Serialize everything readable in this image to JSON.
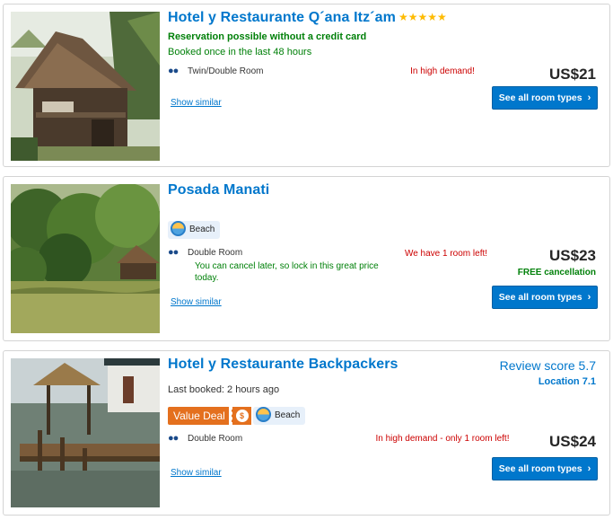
{
  "listings": [
    {
      "name": "Hotel y Restaurante Q´ana Itz´am",
      "stars": "★★★★★",
      "reservation_note": "Reservation possible without a credit card",
      "booked_note": "Booked once in the last 48 hours",
      "room_icon": "people-icon",
      "room_type": "Twin/Double Room",
      "demand": "In high demand!",
      "price": "US$21",
      "cta": "See all room types",
      "similar": "Show similar"
    },
    {
      "name": "Posada Manati",
      "badge": "Beach",
      "badge_icon": "beach-icon",
      "room_icon": "people-icon",
      "room_type": "Double Room",
      "room_note": "You can cancel later, so lock in this great price today.",
      "demand": "We have 1 room left!",
      "price": "US$23",
      "free_cancellation": "FREE cancellation",
      "cta": "See all room types",
      "similar": "Show similar"
    },
    {
      "name": "Hotel y Restaurante Backpackers",
      "review": "Review score 5.7",
      "location": "Location 7.1",
      "last_booked": "Last booked: 2 hours ago",
      "deal": "Value Deal",
      "deal_icon": "piggy-bank-icon",
      "badge": "Beach",
      "badge_icon": "beach-icon",
      "room_icon": "people-icon",
      "room_type": "Double Room",
      "demand": "In high demand - only 1 room left!",
      "price": "US$24",
      "cta": "See all room types",
      "similar": "Show similar"
    }
  ],
  "colors": {
    "link_blue": "#0077cc",
    "success_green": "#008009",
    "urgent_red": "#cc0000",
    "deal_orange": "#e4701e",
    "star_yellow": "#febb02"
  }
}
